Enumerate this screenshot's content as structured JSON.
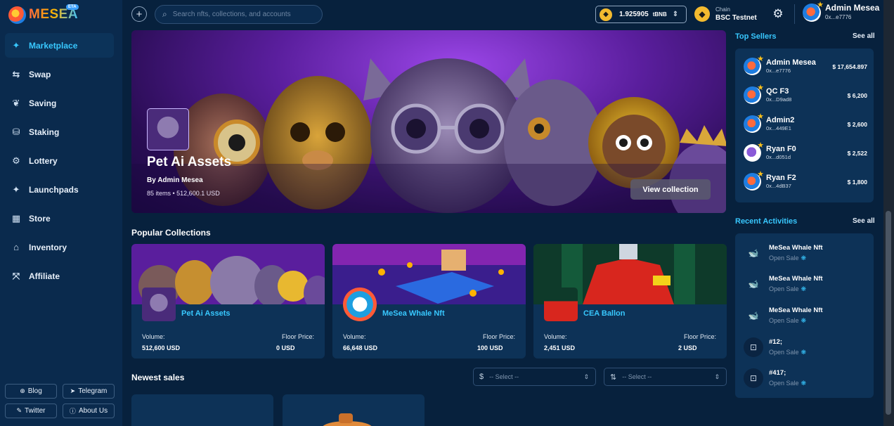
{
  "brand": {
    "name": "MESEA",
    "badge": "ETA"
  },
  "sidebar": {
    "items": [
      {
        "label": "Marketplace",
        "icon": "sparkle-icon",
        "active": true
      },
      {
        "label": "Swap",
        "icon": "swap-icon"
      },
      {
        "label": "Saving",
        "icon": "saving-icon"
      },
      {
        "label": "Staking",
        "icon": "staking-icon"
      },
      {
        "label": "Lottery",
        "icon": "lottery-icon"
      },
      {
        "label": "Launchpads",
        "icon": "launchpad-icon"
      },
      {
        "label": "Store",
        "icon": "store-icon"
      },
      {
        "label": "Inventory",
        "icon": "inventory-icon"
      },
      {
        "label": "Affiliate",
        "icon": "affiliate-icon"
      }
    ],
    "links": [
      {
        "label": "Blog",
        "icon": "globe-icon"
      },
      {
        "label": "Telegram",
        "icon": "telegram-icon"
      },
      {
        "label": "Twitter",
        "icon": "twitter-icon"
      },
      {
        "label": "About Us",
        "icon": "info-icon"
      }
    ]
  },
  "topbar": {
    "search_placeholder": "Search nfts, collections, and accounts",
    "balance": {
      "amount": "1.925905",
      "unit": "tBNB"
    },
    "chain": {
      "label": "Chain",
      "value": "BSC Testnet"
    },
    "profile": {
      "name": "Admin Mesea",
      "address": "0x...e7776"
    }
  },
  "hero": {
    "title": "Pet Ai Assets",
    "by": "By Admin Mesea",
    "meta": "85 items • 512,600.1 USD",
    "button": "View collection"
  },
  "popular": {
    "title": "Popular Collections",
    "volume_label": "Volume:",
    "floor_label": "Floor Price:",
    "cards": [
      {
        "name": "Pet Ai Assets",
        "volume": "512,600 USD",
        "floor": "0 USD"
      },
      {
        "name": "MeSea Whale Nft",
        "volume": "66,648 USD",
        "floor": "100 USD"
      },
      {
        "name": "CEA Ballon",
        "volume": "2,451 USD",
        "floor": "2 USD"
      }
    ]
  },
  "newest": {
    "title": "Newest sales",
    "select_1": "-- Select --",
    "select_2": "-- Select --"
  },
  "top_sellers": {
    "title": "Top Sellers",
    "see_all": "See all",
    "items": [
      {
        "name": "Admin Mesea",
        "address": "0x...e7776",
        "amount": "$ 17,654.897"
      },
      {
        "name": "QC F3",
        "address": "0x...D9ad8",
        "amount": "$ 6,200"
      },
      {
        "name": "Admin2",
        "address": "0x...449E1",
        "amount": "$ 2,600"
      },
      {
        "name": "Ryan F0",
        "address": "0x...d051d",
        "amount": "$ 2,522"
      },
      {
        "name": "Ryan F2",
        "address": "0x...4dB37",
        "amount": "$ 1,800"
      }
    ]
  },
  "recent": {
    "title": "Recent Activities",
    "see_all": "See all",
    "items": [
      {
        "name": "MeSea Whale Nft",
        "status": "Open Sale"
      },
      {
        "name": "MeSea Whale Nft",
        "status": "Open Sale"
      },
      {
        "name": "MeSea Whale Nft",
        "status": "Open Sale"
      },
      {
        "name": "#12;",
        "status": "Open Sale"
      },
      {
        "name": "#417;",
        "status": "Open Sale"
      }
    ]
  },
  "colors": {
    "accent": "#38c8ff",
    "background": "#07213d",
    "panel": "#0d3257",
    "sidebar": "#0a2a4d"
  }
}
